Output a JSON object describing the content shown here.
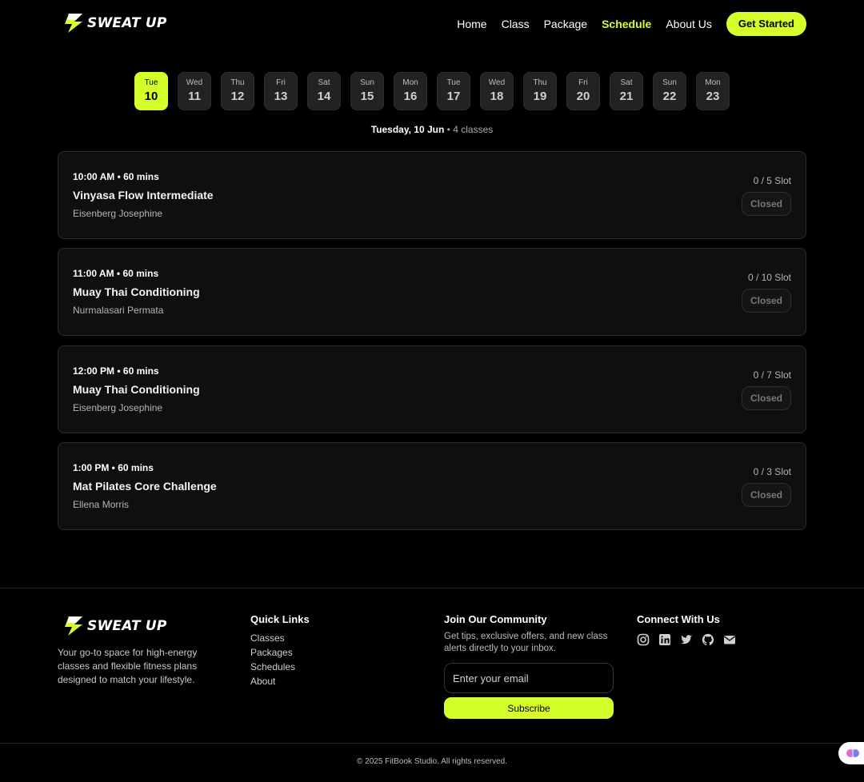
{
  "brand": {
    "name": "SWEAT UP",
    "accent": "#d4ff2a"
  },
  "nav": {
    "items": [
      {
        "label": "Home"
      },
      {
        "label": "Class"
      },
      {
        "label": "Package"
      },
      {
        "label": "Schedule",
        "active": true
      },
      {
        "label": "About Us"
      }
    ],
    "cta": "Get Started"
  },
  "days": [
    {
      "name": "Tue",
      "date": "10",
      "selected": true
    },
    {
      "name": "Wed",
      "date": "11"
    },
    {
      "name": "Thu",
      "date": "12"
    },
    {
      "name": "Fri",
      "date": "13"
    },
    {
      "name": "Sat",
      "date": "14"
    },
    {
      "name": "Sun",
      "date": "15"
    },
    {
      "name": "Mon",
      "date": "16"
    },
    {
      "name": "Tue",
      "date": "17"
    },
    {
      "name": "Wed",
      "date": "18"
    },
    {
      "name": "Thu",
      "date": "19"
    },
    {
      "name": "Fri",
      "date": "20"
    },
    {
      "name": "Sat",
      "date": "21"
    },
    {
      "name": "Sun",
      "date": "22"
    },
    {
      "name": "Mon",
      "date": "23"
    }
  ],
  "summary": {
    "date": "Tuesday, 10 Jun",
    "separator": "•",
    "count": "4 classes"
  },
  "classes": [
    {
      "time": "10:00 AM • 60 mins",
      "title": "Vinyasa Flow Intermediate",
      "coach": "Eisenberg Josephine",
      "slots": "0 / 5 Slot",
      "status": "Closed"
    },
    {
      "time": "11:00 AM • 60 mins",
      "title": "Muay Thai Conditioning",
      "coach": "Nurmalasari Permata",
      "slots": "0 / 10 Slot",
      "status": "Closed"
    },
    {
      "time": "12:00 PM • 60 mins",
      "title": "Muay Thai Conditioning",
      "coach": "Eisenberg Josephine",
      "slots": "0 / 7 Slot",
      "status": "Closed"
    },
    {
      "time": "1:00 PM • 60 mins",
      "title": "Mat Pilates Core Challenge",
      "coach": "Ellena Morris",
      "slots": "0 / 3 Slot",
      "status": "Closed"
    }
  ],
  "footer": {
    "description": "Your go-to space for high-energy classes and flexible fitness plans designed to match your lifestyle.",
    "quick_links_title": "Quick Links",
    "quick_links": [
      "Classes",
      "Packages",
      "Schedules",
      "About"
    ],
    "community_title": "Join Our Community",
    "community_text": "Get tips, exclusive offers, and new class alerts directly to your inbox.",
    "email_placeholder": "Enter your email",
    "subscribe_label": "Subscribe",
    "connect_title": "Connect With Us",
    "social_icons": [
      "instagram-icon",
      "linkedin-icon",
      "twitter-icon",
      "github-icon",
      "mail-icon"
    ],
    "copyright": "© 2025 FitBook Studio. All rights reserved."
  }
}
